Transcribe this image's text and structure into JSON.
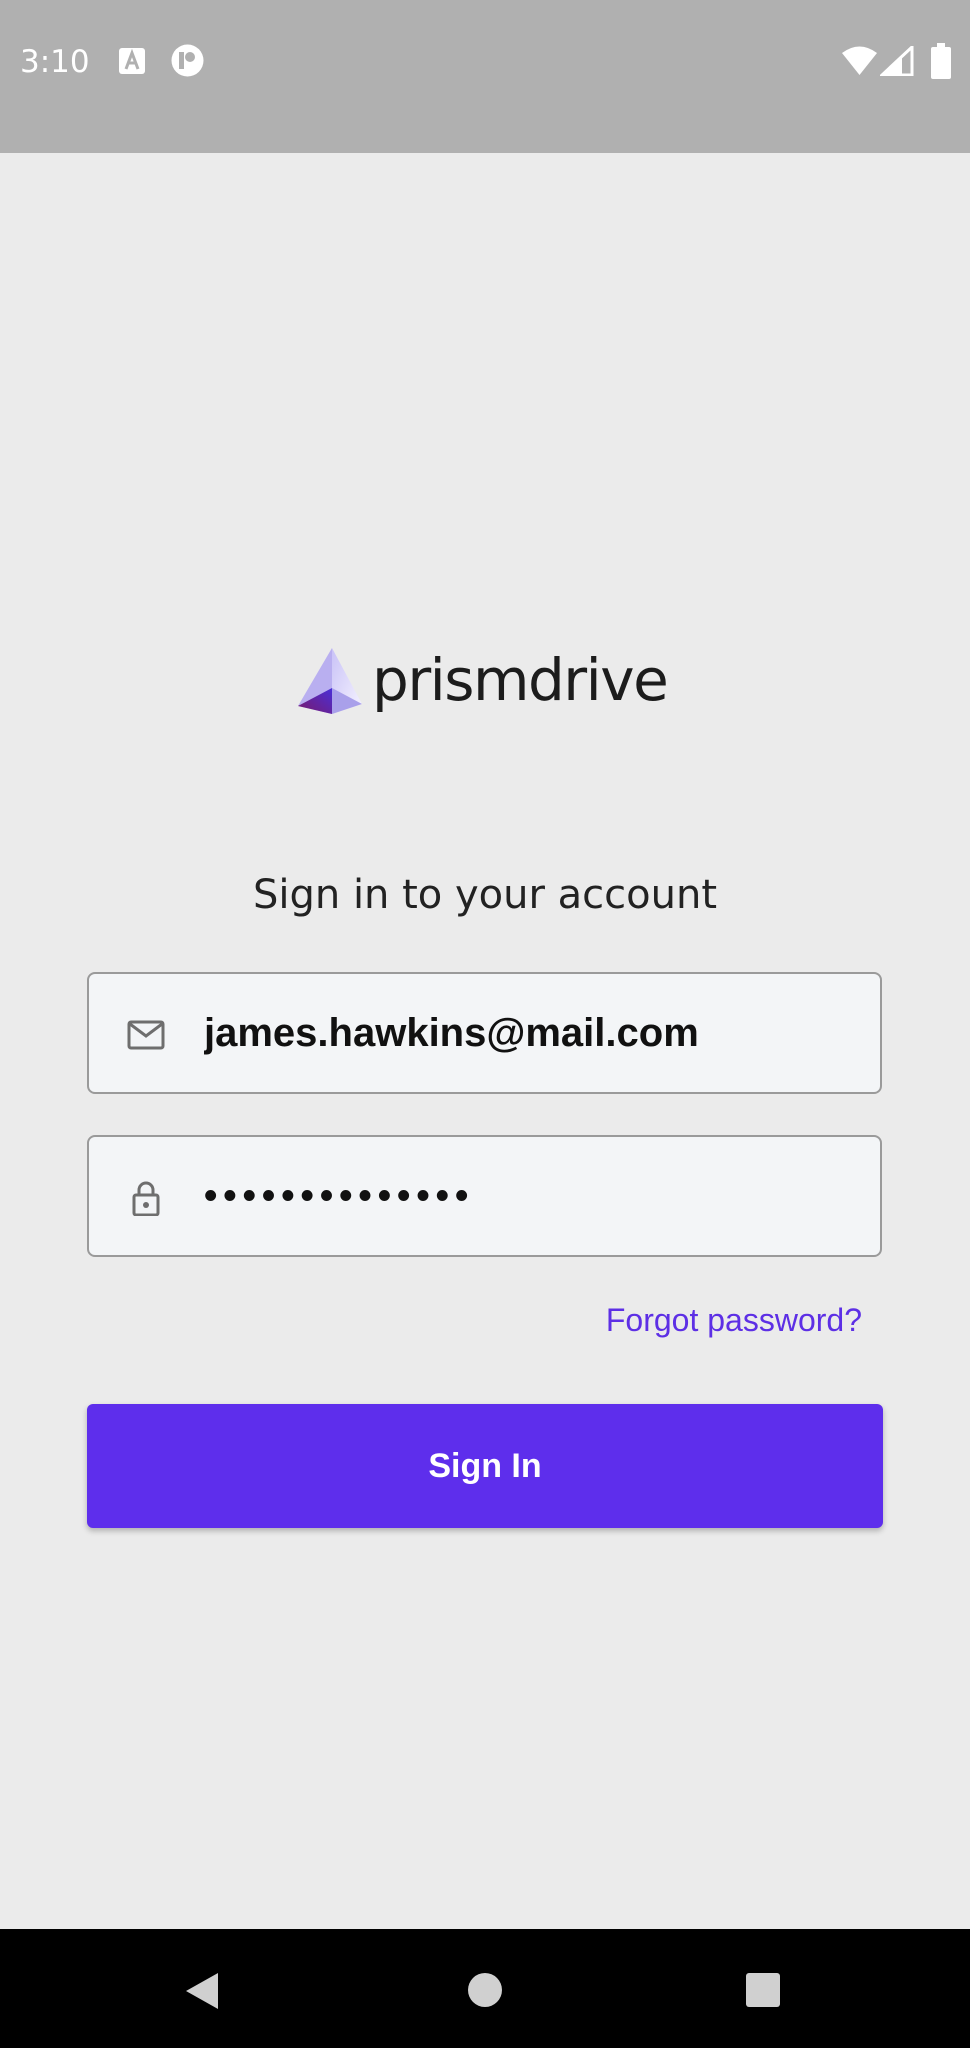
{
  "status_bar": {
    "time": "3:10",
    "icons": [
      "a-box-icon",
      "p-circle-icon",
      "wifi-icon",
      "signal-icon",
      "battery-icon"
    ]
  },
  "app": {
    "name": "prismdrive"
  },
  "login": {
    "headline": "Sign in to your account",
    "email_value": "james.hawkins@mail.com",
    "password_value": "••••••••••••••",
    "forgot_label": "Forgot password?",
    "signin_label": "Sign In"
  },
  "colors": {
    "accent": "#5e2eec",
    "link": "#5d2fe5",
    "background": "#ebebeb",
    "status_bar": "#b0b0b0",
    "nav_bar": "#000000"
  },
  "nav_bar": {
    "icons": [
      "back-icon",
      "home-icon",
      "recent-apps-icon"
    ]
  }
}
